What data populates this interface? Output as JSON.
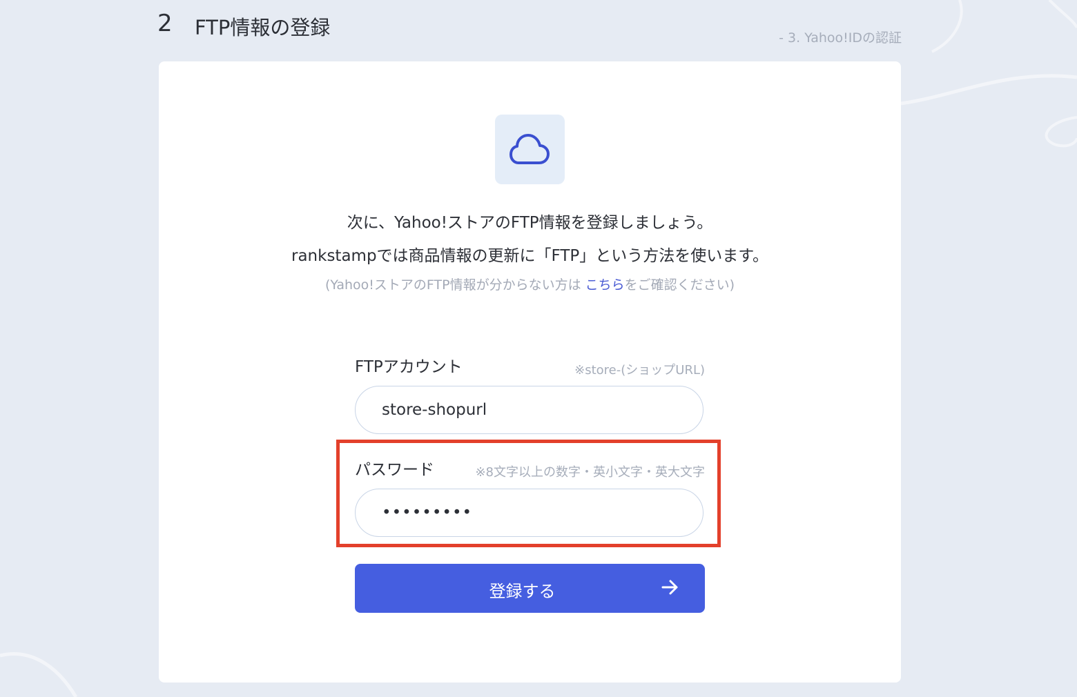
{
  "header": {
    "step_number": "2",
    "step_title": "FTP情報の登録",
    "next_step": "- 3. Yahoo!IDの認証"
  },
  "card": {
    "icon": "cloud-icon",
    "intro_line1": "次に、Yahoo!ストアのFTP情報を登録しましょう。",
    "intro_line2": "rankstampでは商品情報の更新に「FTP」という方法を使います。",
    "help_before": "(Yahoo!ストアのFTP情報が分からない方は ",
    "help_link": "こちら",
    "help_after": "をご確認ください)"
  },
  "form": {
    "ftp_account": {
      "label": "FTPアカウント",
      "hint": "※store-(ショップURL)",
      "value": "store-shopurl"
    },
    "password": {
      "label": "パスワード",
      "hint": "※8文字以上の数字・英小文字・英大文字",
      "value": "•••••••••"
    },
    "submit": {
      "label": "登録する",
      "icon": "arrow-right-icon"
    }
  },
  "colors": {
    "background": "#e6ebf3",
    "accent": "#455ee0",
    "link": "#4a5bd3",
    "highlight": "#e3402b"
  }
}
